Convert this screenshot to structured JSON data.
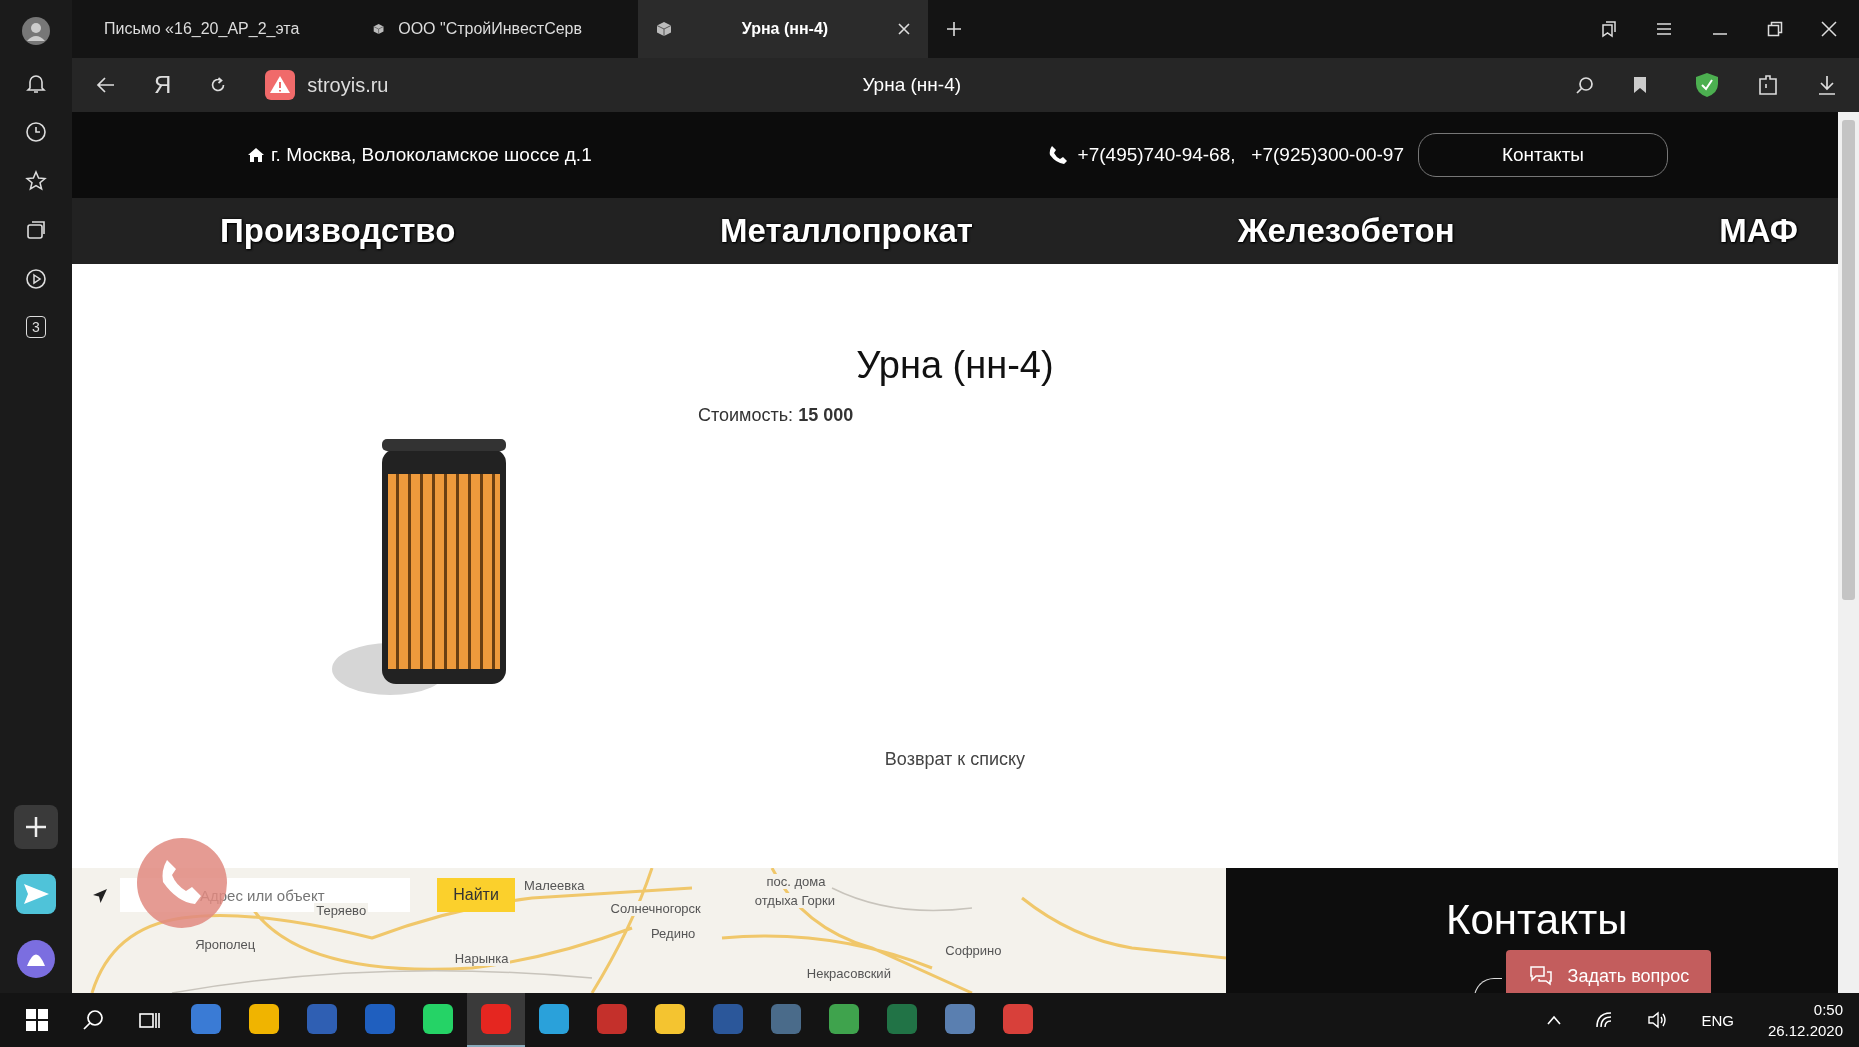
{
  "tabs": [
    {
      "kind": "mail",
      "title": "Письмо «16_20_АР_2_эта",
      "selected": false
    },
    {
      "kind": "site",
      "title": "ООО \"СтройИнвестСерв",
      "selected": false
    },
    {
      "kind": "site",
      "title": "Урна (нн-4)",
      "selected": true
    }
  ],
  "address_bar": {
    "yandex_key": "Я",
    "url": "stroyis.ru",
    "page_title": "Урна (нн-4)"
  },
  "sidebar": {
    "counter": "3"
  },
  "site_header": {
    "address": "г. Москва, Волоколамское шоссе д.1",
    "phones": "+7(495)740-94-68,   +7(925)300-00-97",
    "contacts_button": "Контакты"
  },
  "nav": [
    "Производство",
    "Металлопрокат",
    "Железобетон",
    "МАФ"
  ],
  "product": {
    "title": "Урна (нн-4)",
    "price": "Стоимость: **15 000**",
    "back_link": "Возврат к списку"
  },
  "map": {
    "search_placeholder": "Адрес или объект",
    "search_button": "Найти",
    "places": [
      "Малеевка",
      "Солнечногорск",
      "Редино",
      "пос. дома",
      "отдыха Горки",
      "Теряево",
      "Ярополец",
      "Нарынка",
      "Софрино",
      "Некрасовский"
    ]
  },
  "contacts_panel": {
    "heading": "Контакты",
    "ask_button": "Задать вопрос"
  },
  "taskbar": {
    "apps": [
      {
        "color": "#3a7bd5",
        "selected": false
      },
      {
        "color": "#f0b400",
        "selected": false
      },
      {
        "color": "#2f5fb3",
        "selected": false
      },
      {
        "color": "#1f5fbf",
        "selected": false
      },
      {
        "color": "#25d366",
        "selected": false
      },
      {
        "color": "#e52620",
        "selected": true
      },
      {
        "color": "#2aa1da",
        "selected": false
      },
      {
        "color": "#c4302b",
        "selected": false
      },
      {
        "color": "#f4c430",
        "selected": false
      },
      {
        "color": "#2b579a",
        "selected": false
      },
      {
        "color": "#4a6b8a",
        "selected": false
      },
      {
        "color": "#3fa34d",
        "selected": false
      },
      {
        "color": "#217346",
        "selected": false
      },
      {
        "color": "#5a7fb0",
        "selected": false
      },
      {
        "color": "#d8403a",
        "selected": false
      }
    ],
    "language": "ENG",
    "time": "0:50",
    "date": "26.12.2020"
  }
}
